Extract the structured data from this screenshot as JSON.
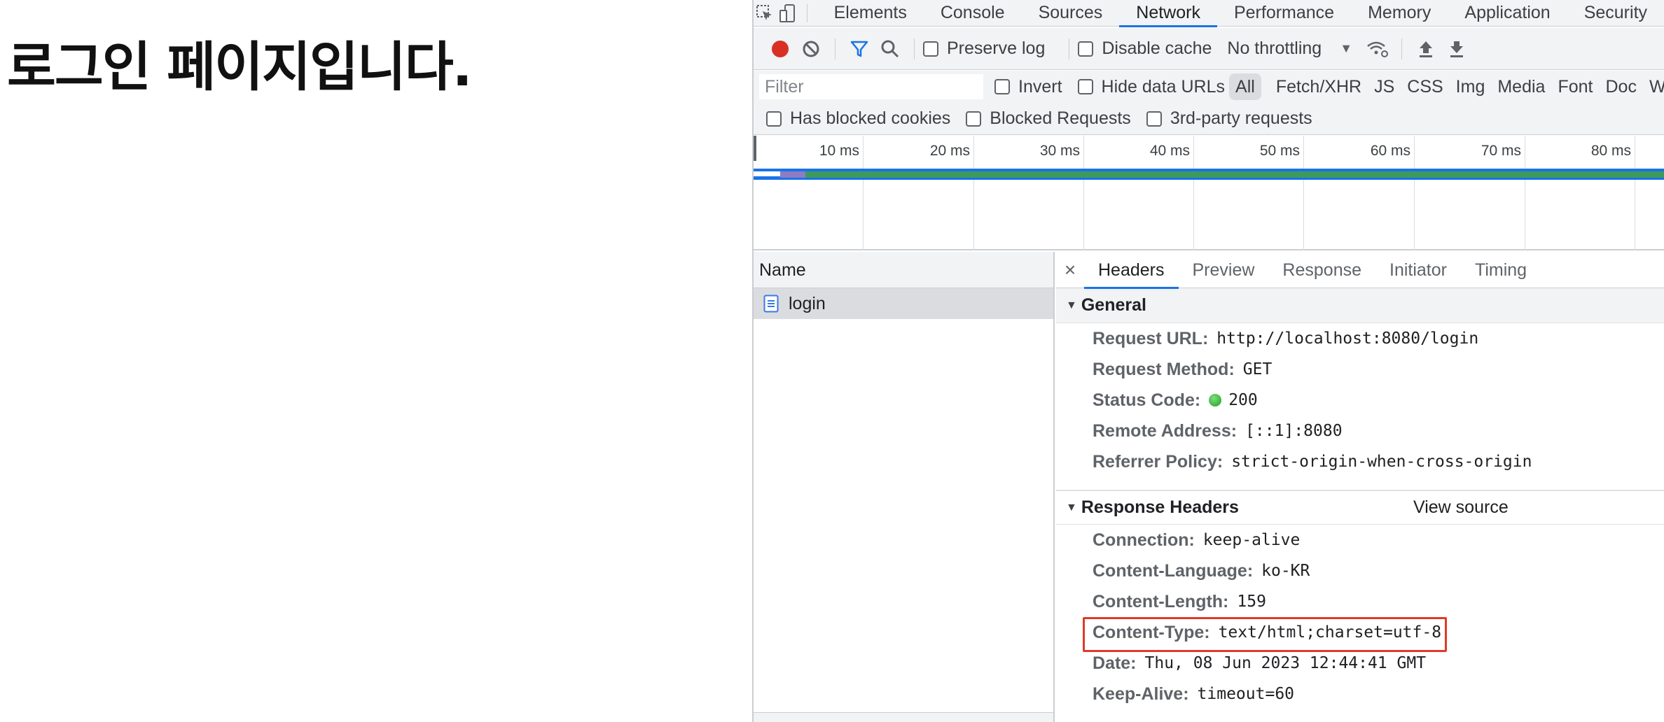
{
  "page": {
    "heading": "로그인 페이지입니다."
  },
  "devtools": {
    "tabs": [
      "Elements",
      "Console",
      "Sources",
      "Network",
      "Performance",
      "Memory",
      "Application",
      "Security"
    ],
    "active_tab": "Network",
    "toolbar": {
      "preserve_log": "Preserve log",
      "disable_cache": "Disable cache",
      "throttling": "No throttling"
    },
    "filter": {
      "placeholder": "Filter",
      "invert": "Invert",
      "hide_data_urls": "Hide data URLs",
      "types": [
        "All",
        "Fetch/XHR",
        "JS",
        "CSS",
        "Img",
        "Media",
        "Font",
        "Doc",
        "W"
      ]
    },
    "filter2": {
      "blocked_cookies": "Has blocked cookies",
      "blocked_requests": "Blocked Requests",
      "third_party": "3rd-party requests"
    },
    "timeline": {
      "ticks": [
        "10 ms",
        "20 ms",
        "30 ms",
        "40 ms",
        "50 ms",
        "60 ms",
        "70 ms",
        "80 ms"
      ]
    },
    "requests": {
      "column": "Name",
      "items": [
        "login"
      ]
    },
    "details": {
      "tabs": [
        "Headers",
        "Preview",
        "Response",
        "Initiator",
        "Timing"
      ],
      "general": {
        "title": "General",
        "rows": [
          {
            "key": "Request URL:",
            "value": "http://localhost:8080/login"
          },
          {
            "key": "Request Method:",
            "value": "GET"
          },
          {
            "key": "Status Code:",
            "value": "200"
          },
          {
            "key": "Remote Address:",
            "value": "[::1]:8080"
          },
          {
            "key": "Referrer Policy:",
            "value": "strict-origin-when-cross-origin"
          }
        ]
      },
      "response": {
        "title": "Response Headers",
        "view_source": "View source",
        "rows": [
          {
            "key": "Connection:",
            "value": "keep-alive"
          },
          {
            "key": "Content-Language:",
            "value": "ko-KR"
          },
          {
            "key": "Content-Length:",
            "value": "159"
          },
          {
            "key": "Content-Type:",
            "value": "text/html;charset=utf-8"
          },
          {
            "key": "Date:",
            "value": "Thu, 08 Jun 2023 12:44:41 GMT"
          },
          {
            "key": "Keep-Alive:",
            "value": "timeout=60"
          }
        ]
      }
    }
  }
}
